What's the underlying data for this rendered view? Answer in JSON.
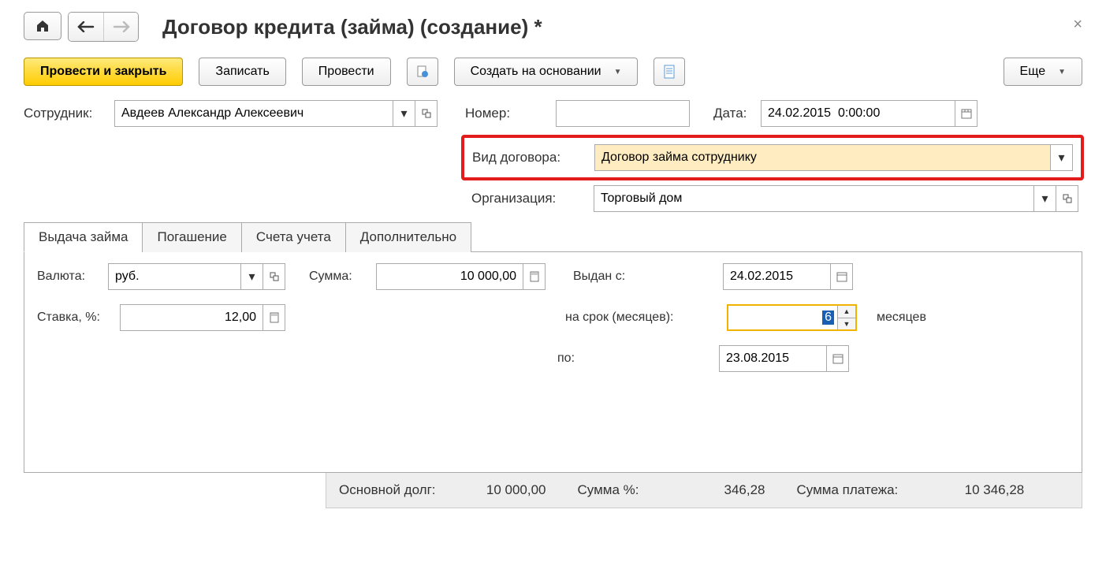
{
  "title": "Договор кредита (займа) (создание) *",
  "toolbar": {
    "post_close": "Провести и закрыть",
    "save": "Записать",
    "post": "Провести",
    "create_based": "Создать на основании",
    "more": "Еще"
  },
  "fields": {
    "employee_label": "Сотрудник:",
    "employee_value": "Авдеев Александр Алексеевич",
    "number_label": "Номер:",
    "number_value": "",
    "date_label": "Дата:",
    "date_value": "24.02.2015  0:00:00",
    "contract_type_label": "Вид договора:",
    "contract_type_value": "Договор займа сотруднику",
    "org_label": "Организация:",
    "org_value": "Торговый дом"
  },
  "tabs": {
    "t1": "Выдача займа",
    "t2": "Погашение",
    "t3": "Счета учета",
    "t4": "Дополнительно"
  },
  "loan": {
    "currency_label": "Валюта:",
    "currency_value": "руб.",
    "sum_label": "Сумма:",
    "sum_value": "10 000,00",
    "rate_label": "Ставка, %:",
    "rate_value": "12,00",
    "issued_label": "Выдан с:",
    "issued_value": "24.02.2015",
    "term_label": "на срок (месяцев):",
    "term_value": "6",
    "term_unit": "месяцев",
    "to_label": "по:",
    "to_value": "23.08.2015"
  },
  "footer": {
    "principal_label": "Основной долг:",
    "principal_value": "10 000,00",
    "percent_label": "Сумма %:",
    "percent_value": "346,28",
    "payment_label": "Сумма платежа:",
    "payment_value": "10 346,28"
  }
}
